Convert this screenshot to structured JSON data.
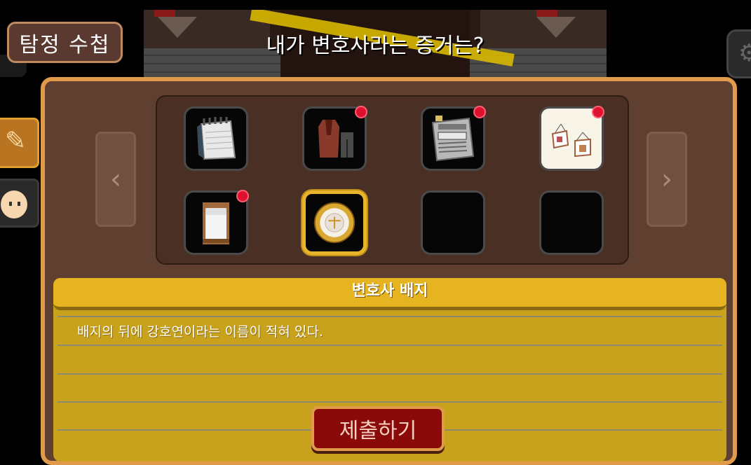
{
  "header": {
    "notebook_tab_label": "탐정 수첩",
    "question": "내가 변호사라는 증거는?"
  },
  "inventory": {
    "slots": [
      {
        "item": "notepad-icon",
        "new": false,
        "selected": false,
        "empty": false
      },
      {
        "item": "coat-and-pants-icon",
        "new": true,
        "selected": false,
        "empty": false
      },
      {
        "item": "newspaper-icon",
        "new": true,
        "selected": false,
        "empty": false
      },
      {
        "item": "frames-icon",
        "new": true,
        "selected": false,
        "empty": false
      },
      {
        "item": "bed-icon",
        "new": true,
        "selected": false,
        "empty": false
      },
      {
        "item": "lawyer-badge-icon",
        "new": false,
        "selected": true,
        "empty": false
      },
      {
        "item": "empty-slot",
        "new": false,
        "selected": false,
        "empty": true
      },
      {
        "item": "empty-slot",
        "new": false,
        "selected": false,
        "empty": true
      }
    ],
    "prev_arrow": "‹",
    "next_arrow": "›"
  },
  "description": {
    "title": "변호사 배지",
    "text": "배지의 뒤에 강호연이라는 이름이 적혀 있다."
  },
  "actions": {
    "submit_label": "제출하기"
  },
  "colors": {
    "panel": "#5e3f30",
    "panel_border": "#e09a4a",
    "selected_border": "#e8b52a",
    "new_dot": "#e01030",
    "submit": "#8a0a0a"
  }
}
